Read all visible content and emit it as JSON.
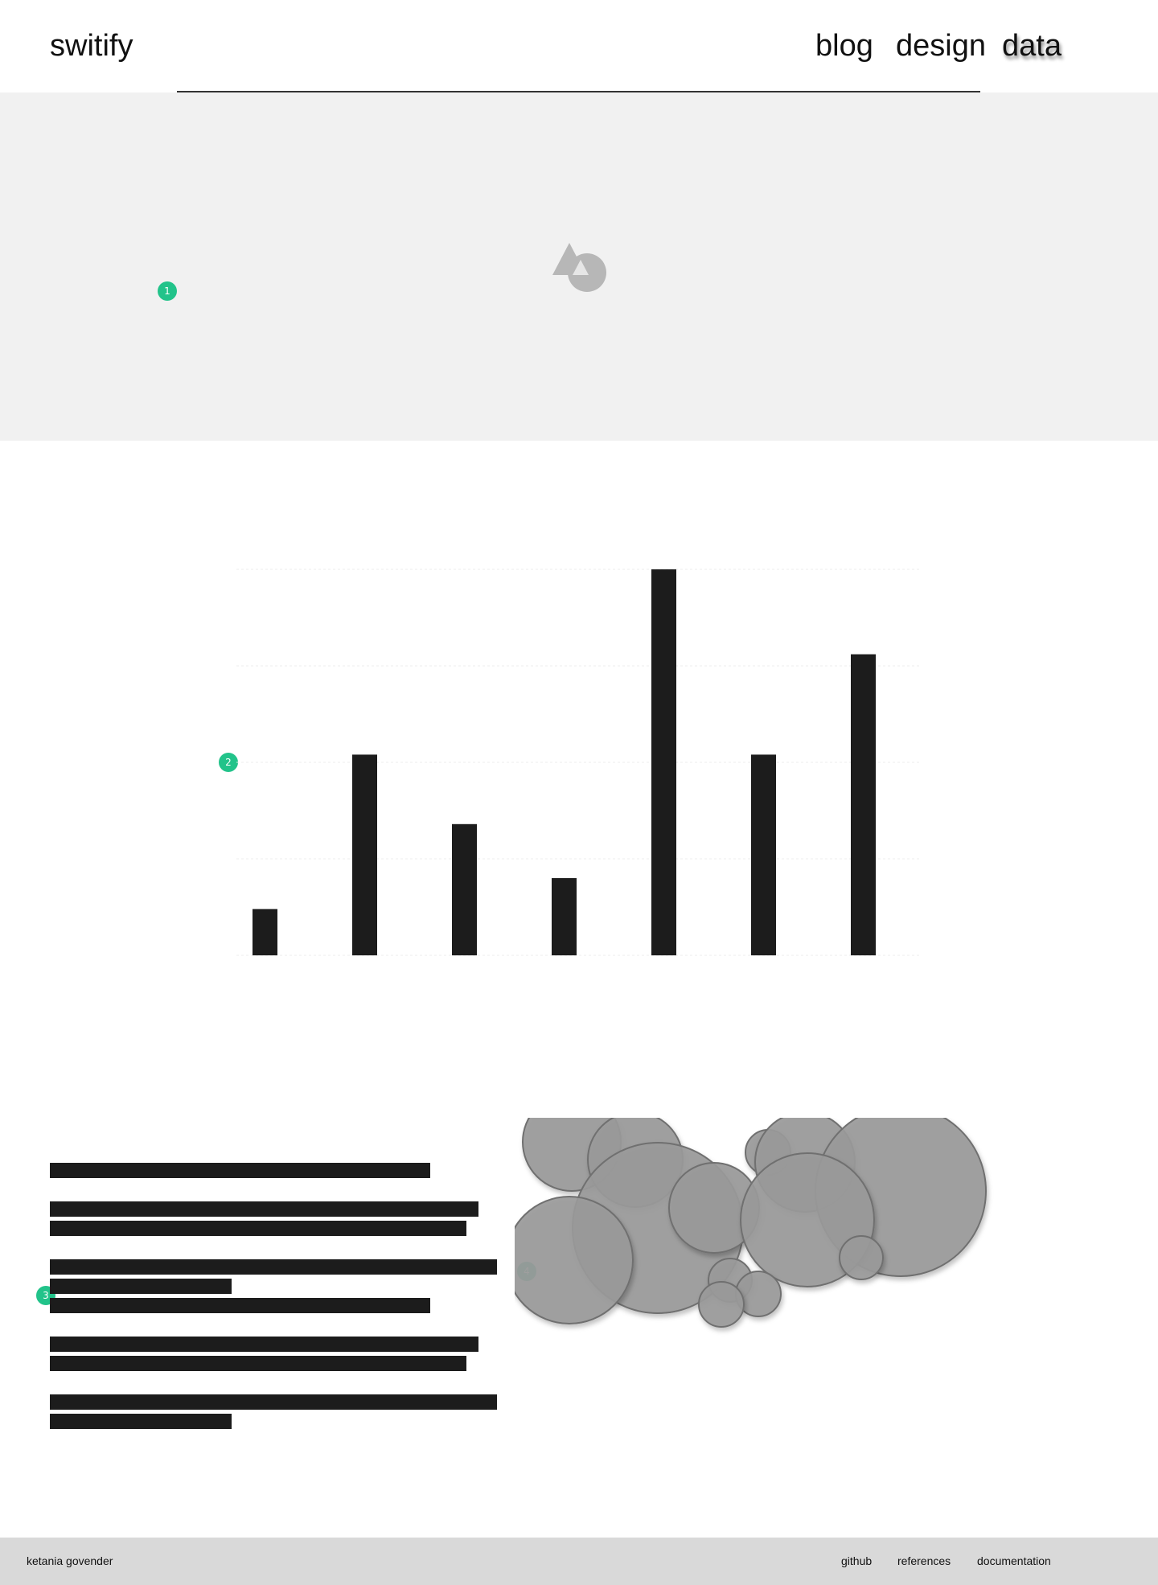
{
  "header": {
    "brand": "switify",
    "nav": [
      {
        "label": "blog"
      },
      {
        "label": "design"
      },
      {
        "label": "data"
      }
    ]
  },
  "hero": {
    "logo_icon": "shapes-icon"
  },
  "markers": [
    "1",
    "2",
    "3",
    "4"
  ],
  "chart_data": {
    "type": "bar",
    "categories": [
      "",
      "",
      "",
      "",
      "",
      "",
      ""
    ],
    "values": [
      12,
      52,
      34,
      20,
      100,
      52,
      78
    ],
    "ylim": [
      0,
      100
    ],
    "grid": true,
    "color": "#1c1c1c"
  },
  "bubbles": {
    "type": "scatter",
    "color": "#9a9a9a",
    "values": [
      {
        "x": 51,
        "y": 18,
        "r": 61
      },
      {
        "x": 130,
        "y": 40,
        "r": 59
      },
      {
        "x": 158,
        "y": 125,
        "r": 106
      },
      {
        "x": 228,
        "y": 100,
        "r": 56
      },
      {
        "x": 295,
        "y": 31,
        "r": 28
      },
      {
        "x": 341,
        "y": 43,
        "r": 62
      },
      {
        "x": 460,
        "y": 79,
        "r": 106
      },
      {
        "x": 344,
        "y": 115,
        "r": 83
      },
      {
        "x": 248,
        "y": 190,
        "r": 27
      },
      {
        "x": 48,
        "y": 165,
        "r": 79
      },
      {
        "x": 411,
        "y": 162,
        "r": 27
      },
      {
        "x": 283,
        "y": 207,
        "r": 28
      },
      {
        "x": 237,
        "y": 220,
        "r": 28
      }
    ]
  },
  "footer": {
    "name": "ketania govender",
    "links": [
      {
        "label": "github"
      },
      {
        "label": "references"
      },
      {
        "label": "documentation"
      }
    ]
  }
}
